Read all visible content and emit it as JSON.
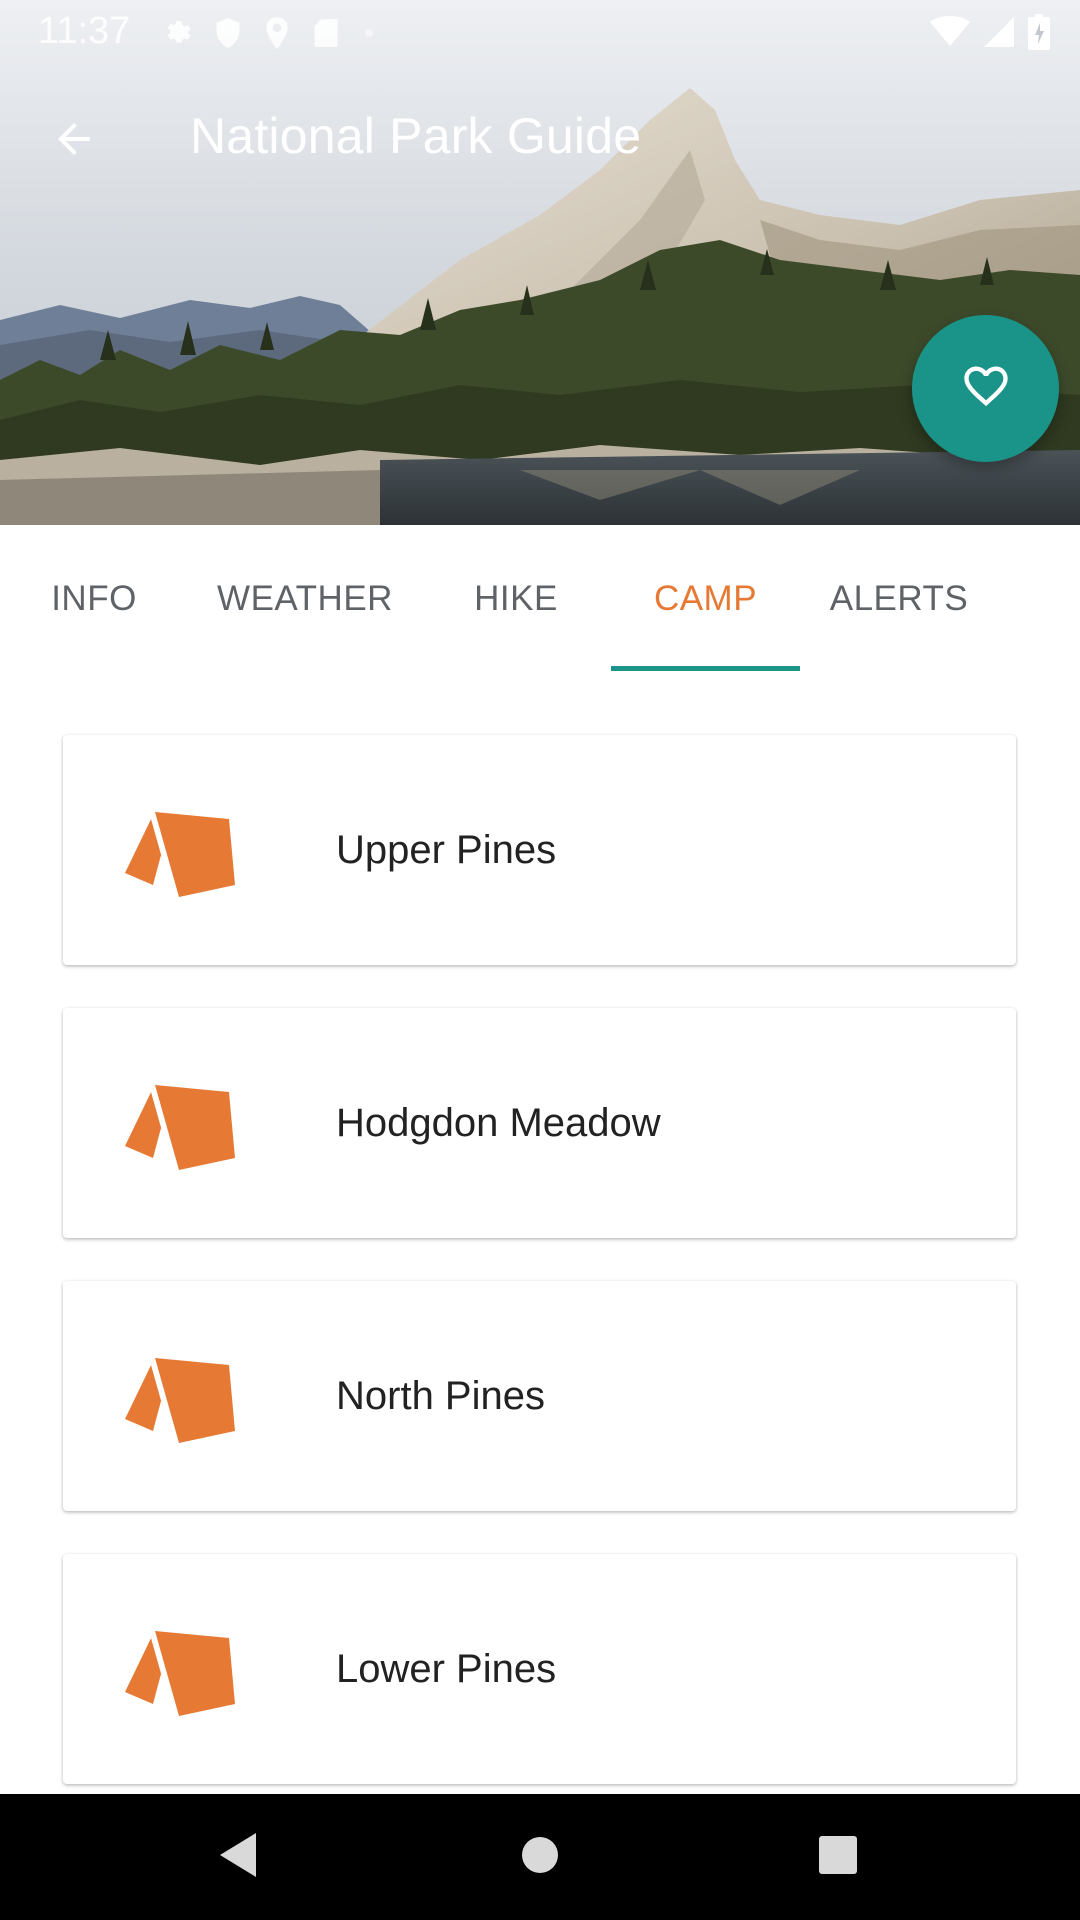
{
  "status_bar": {
    "time": "11:37",
    "left_icons": [
      "settings-icon",
      "shield-icon",
      "location-icon",
      "sd-card-icon",
      "dot-icon"
    ],
    "right_icons": [
      "wifi-icon",
      "cell-signal-icon",
      "battery-icon"
    ]
  },
  "app_bar": {
    "title": "National Park Guide",
    "back_icon": "arrow-back-icon"
  },
  "hero": {
    "image": "mountain-lake-landscape"
  },
  "fab": {
    "icon": "heart-outline-icon",
    "color": "#1a9489"
  },
  "tabs": {
    "items": [
      {
        "label": "INFO"
      },
      {
        "label": "WEATHER"
      },
      {
        "label": "HIKE"
      },
      {
        "label": "CAMP"
      },
      {
        "label": "ALERTS"
      }
    ],
    "active": "CAMP",
    "active_color": "#e67a35",
    "indicator_color": "#1a9489"
  },
  "camps": [
    {
      "name": "Upper Pines",
      "icon": "tent-icon"
    },
    {
      "name": "Hodgdon Meadow",
      "icon": "tent-icon"
    },
    {
      "name": "North Pines",
      "icon": "tent-icon"
    },
    {
      "name": "Lower Pines",
      "icon": "tent-icon"
    }
  ],
  "nav_bar": {
    "buttons": [
      "back-triangle-icon",
      "home-circle-icon",
      "recents-square-icon"
    ]
  },
  "colors": {
    "accent": "#1a9489",
    "tent": "#e67a35"
  }
}
